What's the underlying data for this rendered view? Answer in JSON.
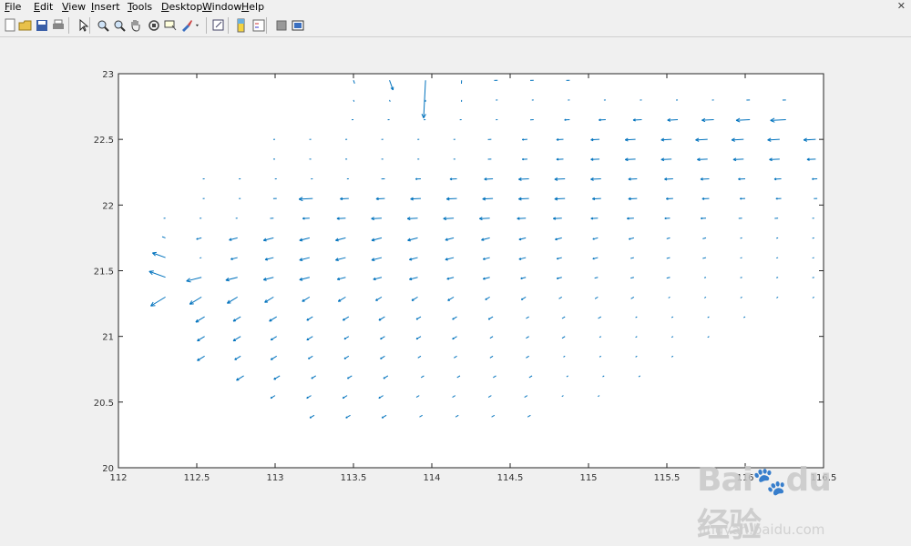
{
  "menu": {
    "items": [
      {
        "label": "File",
        "key": "F",
        "rest": "ile"
      },
      {
        "label": "Edit",
        "key": "E",
        "rest": "dit"
      },
      {
        "label": "View",
        "key": "V",
        "rest": "iew"
      },
      {
        "label": "Insert",
        "key": "I",
        "rest": "nsert"
      },
      {
        "label": "Tools",
        "key": "T",
        "rest": "ools"
      },
      {
        "label": "Desktop",
        "key": "D",
        "rest": "esktop"
      },
      {
        "label": "Window",
        "key": "W",
        "rest": "indow"
      },
      {
        "label": "Help",
        "key": "H",
        "rest": "elp"
      }
    ],
    "close_glyph": "✕"
  },
  "toolbar": {
    "buttons": [
      {
        "name": "new-figure-icon"
      },
      {
        "name": "open-file-icon"
      },
      {
        "name": "save-icon"
      },
      {
        "name": "print-icon"
      },
      {
        "name": "pointer-icon"
      },
      {
        "name": "zoom-in-icon"
      },
      {
        "name": "zoom-out-icon"
      },
      {
        "name": "pan-hand-icon"
      },
      {
        "name": "rotate-3d-icon"
      },
      {
        "name": "data-cursor-icon"
      },
      {
        "name": "brush-icon"
      },
      {
        "name": "dropdown-arrow-icon"
      },
      {
        "name": "link-plot-icon"
      },
      {
        "name": "colorbar-icon"
      },
      {
        "name": "legend-icon"
      },
      {
        "name": "hide-plot-tools-icon"
      },
      {
        "name": "show-plot-tools-icon"
      }
    ]
  },
  "colors": {
    "quiver": "#0072bd",
    "axes": "#262626"
  },
  "chart_data": {
    "type": "quiver",
    "title": "",
    "xlabel": "",
    "ylabel": "",
    "xlim": [
      112,
      116.5
    ],
    "ylim": [
      20,
      23
    ],
    "xticks": [
      "112",
      "112.5",
      "113",
      "113.5",
      "114",
      "114.5",
      "115",
      "115.5",
      "116",
      "116.5"
    ],
    "yticks": [
      "20",
      "20.5",
      "21",
      "21.5",
      "22",
      "22.5",
      "23"
    ],
    "grid": false,
    "legend": "none",
    "rows": [
      {
        "y": 22.95,
        "x0": 113.5,
        "u": [
          0.02,
          0.06,
          0.22,
          0.02,
          0.02,
          0.02,
          0.02
        ]
      },
      {
        "y": 22.8,
        "x0": 113.5,
        "u": [
          0.01,
          0.01,
          0.01,
          0.01,
          0.01,
          0.01,
          0.01,
          0.01,
          0.01,
          0.01,
          0.01,
          0.02,
          0.02
        ]
      },
      {
        "y": 22.65,
        "x0": 113.5,
        "u": [
          0.01,
          0.01,
          0.01,
          0.01,
          0.01,
          0.02,
          0.03,
          0.04,
          0.05,
          0.06,
          0.07,
          0.08,
          0.09
        ]
      },
      {
        "y": 22.5,
        "x0": 113.0,
        "u": [
          0.01,
          0.01,
          0.01,
          0.01,
          0.01,
          0.01,
          0.02,
          0.03,
          0.04,
          0.05,
          0.06,
          0.06,
          0.07,
          0.07,
          0.07,
          0.07
        ]
      },
      {
        "y": 22.35,
        "x0": 113.0,
        "u": [
          0.01,
          0.01,
          0.01,
          0.01,
          0.01,
          0.01,
          0.02,
          0.03,
          0.04,
          0.05,
          0.06,
          0.06,
          0.06,
          0.06,
          0.06,
          0.05
        ]
      },
      {
        "y": 22.2,
        "x0": 112.55,
        "u": [
          0.01,
          0.01,
          0.01,
          0.01,
          0.01,
          0.02,
          0.03,
          0.04,
          0.05,
          0.06,
          0.06,
          0.06,
          0.05,
          0.05,
          0.05,
          0.04,
          0.04,
          0.03
        ]
      },
      {
        "y": 22.05,
        "x0": 112.55,
        "u": [
          0.01,
          0.01,
          0.02,
          0.08,
          0.05,
          0.05,
          0.06,
          0.06,
          0.06,
          0.06,
          0.06,
          0.05,
          0.05,
          0.04,
          0.04,
          0.03,
          0.03,
          0.02
        ]
      },
      {
        "y": 21.9,
        "x0": 112.3,
        "u": [
          0.01,
          0.01,
          0.01,
          0.02,
          0.04,
          0.05,
          0.06,
          0.06,
          0.06,
          0.06,
          0.05,
          0.05,
          0.04,
          0.04,
          0.03,
          0.03,
          0.02,
          0.02,
          0.01
        ]
      },
      {
        "y": 21.75,
        "x0": 112.3,
        "u": [
          0.02,
          0.03,
          0.05,
          0.06,
          0.06,
          0.06,
          0.06,
          0.06,
          0.05,
          0.05,
          0.04,
          0.04,
          0.03,
          0.03,
          0.02,
          0.02,
          0.01,
          0.01,
          0.01
        ]
      },
      {
        "y": 21.6,
        "x0": 112.3,
        "u": [
          0.08,
          0.01,
          0.04,
          0.05,
          0.06,
          0.06,
          0.06,
          0.05,
          0.05,
          0.04,
          0.04,
          0.03,
          0.03,
          0.02,
          0.02,
          0.02,
          0.01,
          0.01,
          0.01
        ]
      },
      {
        "y": 21.45,
        "x0": 112.3,
        "u": [
          0.1,
          0.09,
          0.07,
          0.06,
          0.06,
          0.05,
          0.05,
          0.05,
          0.04,
          0.04,
          0.03,
          0.03,
          0.02,
          0.02,
          0.02,
          0.01,
          0.01,
          0.01,
          0.01
        ]
      },
      {
        "y": 21.3,
        "x0": 112.3,
        "u": [
          0.1,
          0.08,
          0.07,
          0.06,
          0.05,
          0.05,
          0.04,
          0.04,
          0.04,
          0.03,
          0.03,
          0.02,
          0.02,
          0.02,
          0.01,
          0.01,
          0.01,
          0.01,
          0.01
        ]
      },
      {
        "y": 21.15,
        "x0": 112.55,
        "u": [
          0.06,
          0.05,
          0.05,
          0.04,
          0.04,
          0.04,
          0.03,
          0.03,
          0.03,
          0.02,
          0.02,
          0.02,
          0.01,
          0.01,
          0.01,
          0.01
        ]
      },
      {
        "y": 21.0,
        "x0": 112.55,
        "u": [
          0.05,
          0.05,
          0.04,
          0.04,
          0.03,
          0.03,
          0.03,
          0.03,
          0.02,
          0.02,
          0.02,
          0.01,
          0.01,
          0.01,
          0.01
        ]
      },
      {
        "y": 20.85,
        "x0": 112.55,
        "u": [
          0.05,
          0.04,
          0.04,
          0.03,
          0.03,
          0.03,
          0.02,
          0.02,
          0.02,
          0.02,
          0.01,
          0.01,
          0.01,
          0.01
        ]
      },
      {
        "y": 20.7,
        "x0": 112.8,
        "u": [
          0.05,
          0.04,
          0.03,
          0.03,
          0.03,
          0.02,
          0.02,
          0.02,
          0.02,
          0.01,
          0.01,
          0.01
        ]
      },
      {
        "y": 20.55,
        "x0": 113.0,
        "u": [
          0.03,
          0.03,
          0.03,
          0.03,
          0.02,
          0.02,
          0.02,
          0.02,
          0.01,
          0.01
        ]
      },
      {
        "y": 20.4,
        "x0": 113.25,
        "u": [
          0.03,
          0.03,
          0.03,
          0.02,
          0.02,
          0.02,
          0.02
        ]
      }
    ],
    "dx": 0.23,
    "direction": "mostly westward; southwest along coast; south near x 113.5-114.2 at top"
  },
  "watermark": {
    "logo_text": "Bai du 经验",
    "url": "jingyan.baidu.com"
  }
}
